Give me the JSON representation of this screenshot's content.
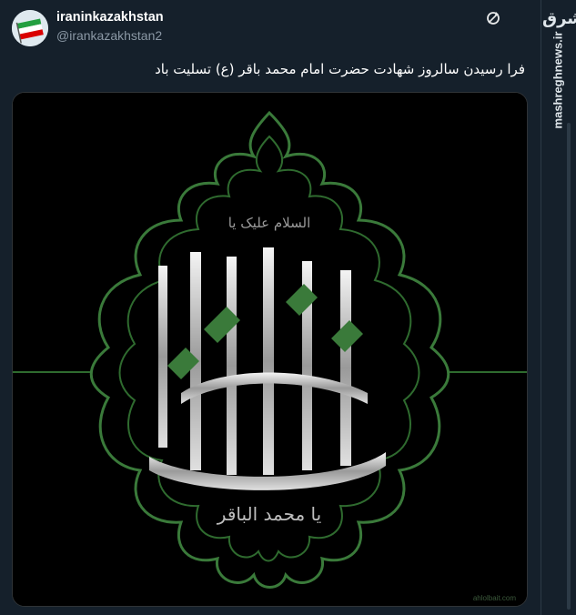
{
  "account": {
    "display_name": "iraninkazakhstan",
    "handle": "@irankazakhstan2",
    "avatar_icon": "iran-flag-avatar"
  },
  "tweet": {
    "text": "فرا رسیدن سالروز شهادت حضرت امام محمد باقر (ع) تسلیت باد",
    "icon": "refresh-circle-icon"
  },
  "image": {
    "small_calligraphy": "السلام علیک یا",
    "main_calligraphy": "یا محمد الباقر",
    "credit": "ahlolbait.com"
  },
  "site": {
    "logo_text": "مشرق",
    "watermark": "mashreghnews.ir"
  },
  "colors": {
    "background": "#15202b",
    "ornament_green": "#3a7a3a",
    "text_secondary": "#8b98a5"
  }
}
